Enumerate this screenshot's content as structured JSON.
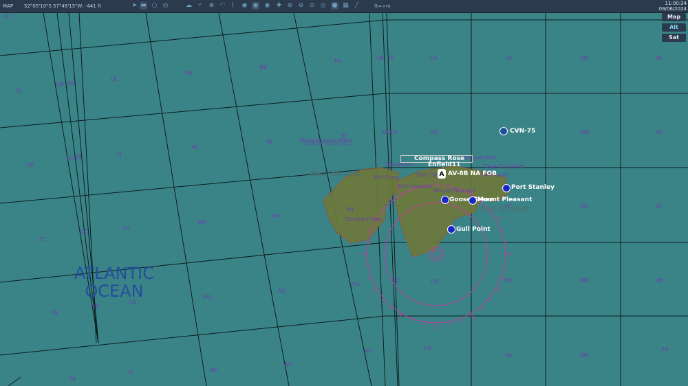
{
  "topbar": {
    "mode": "MAP",
    "coordinates": "52°05'10\"S 57°49'15\"W, -441 ft",
    "unit_toggle": "ft=>m",
    "time": "11:00:34",
    "date": "09/06/2024",
    "tools": [
      "navigate-icon",
      "toggle-icon",
      "circle-icon",
      "layers-icon",
      "cloud-icon",
      "network-icon",
      "target-icon",
      "wifi-icon",
      "tower-icon",
      "radar-1-icon",
      "radar-2-icon",
      "radar-3-icon",
      "move-icon",
      "zoom-in-icon",
      "zoom-out-icon",
      "zoom-fit-icon",
      "bullseye-icon",
      "globe-icon",
      "grid-icon",
      "pencil-icon"
    ]
  },
  "map_buttons": [
    "Map",
    "Alt",
    "Sat"
  ],
  "grid_labels": [
    "FF",
    "FE",
    "GE",
    "KK",
    "LK",
    "MK",
    "NK",
    "PK",
    "QK",
    "TE",
    "UE",
    "VE",
    "WE",
    "XE",
    "FD",
    "GD",
    "KJ",
    "LJ",
    "MJ",
    "NJ",
    "PJ",
    "QD",
    "TD",
    "UD",
    "WD",
    "XD",
    "FC",
    "GC",
    "LH",
    "MH",
    "NH",
    "PH",
    "VC",
    "WC",
    "XC",
    "FB",
    "GB",
    "LG",
    "MG",
    "NG",
    "PG",
    "QC",
    "UB",
    "VB",
    "WB",
    "XB",
    "FA",
    "LF",
    "MF",
    "NF",
    "PF",
    "UA",
    "VA",
    "WA",
    "XA"
  ],
  "regions": {
    "west": "West Falklands",
    "east": "East Falklands",
    "ocean_1": "ATLANTIC",
    "ocean_2": "OCEAN"
  },
  "places": [
    "Steeple Jason West",
    "Steeple Jason East",
    "Hill Cove",
    "Port Howard",
    "Double Creek",
    "Westpoint",
    "San Carlos",
    "Bougainville",
    "Cape Carysfort",
    "Port Louis",
    "Mount Pleasant"
  ],
  "units": {
    "carrier": "CVN-75",
    "stanley": "Port Stanley",
    "goose": "Goose Green",
    "pleasant": "Mount Pleasant",
    "gull": "Gull Point",
    "fob": "AV-8B NA FOB",
    "compass": "Compass Rose",
    "enfield": "Enfield11"
  },
  "colors": {
    "water": "#3a8488",
    "land": "#6e7a3a",
    "roads": "#c0392b",
    "compass": "#c23d9e",
    "grid_text": "#6a3fa8",
    "toolbar": "#2b3a4c"
  }
}
